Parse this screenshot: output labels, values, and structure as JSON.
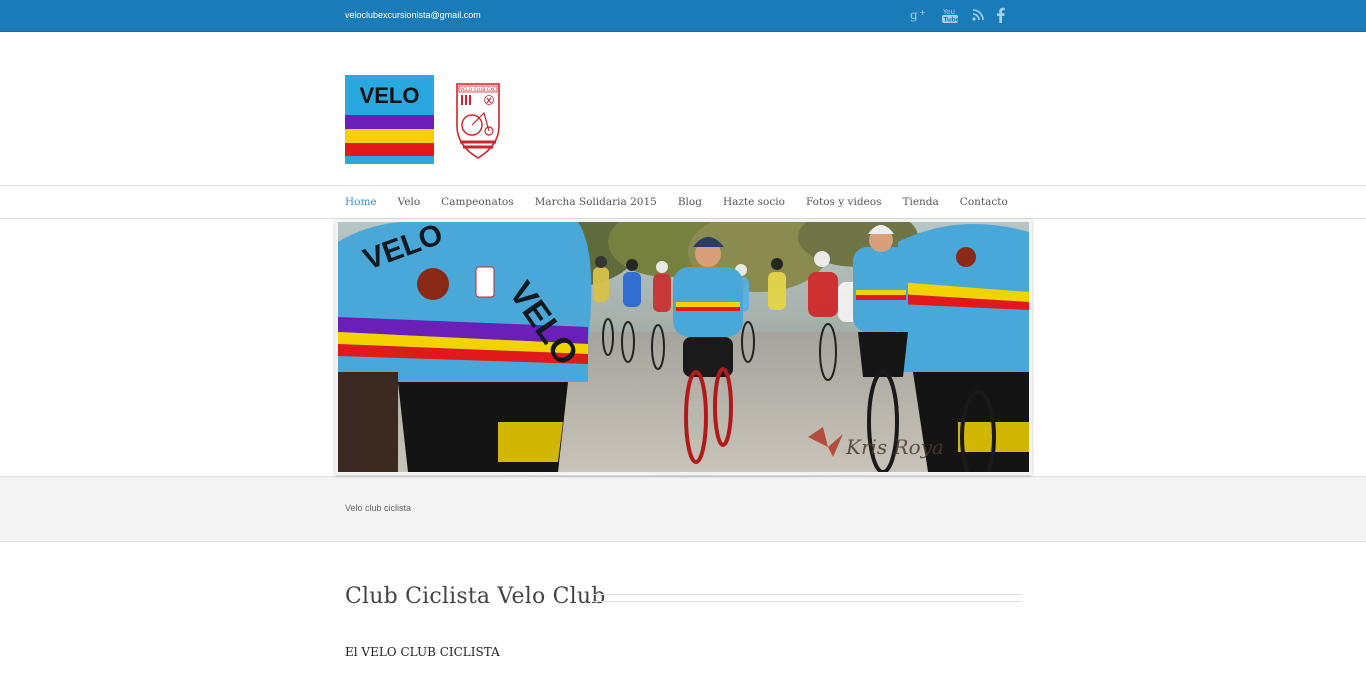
{
  "topbar": {
    "email": "veloclubexcursionista@gmail.com",
    "social": [
      {
        "name": "google-plus-icon",
        "glyph": "g+"
      },
      {
        "name": "youtube-icon",
        "glyph": "You Tube"
      },
      {
        "name": "rss-icon",
        "glyph": "rss"
      },
      {
        "name": "facebook-icon",
        "glyph": "f"
      }
    ]
  },
  "header": {
    "logo_text": "VELO",
    "badge_text": "VELO CLUB EXC"
  },
  "nav": {
    "items": [
      "Home",
      "Velo",
      "Campeonatos",
      "Marcha Solidaria 2015",
      "Blog",
      "Hazte socio",
      "Fotos y videos",
      "Tienda",
      "Contacto"
    ],
    "active": "Home"
  },
  "slider": {
    "watermark": "Kris Roya"
  },
  "tagline": "Velo club ciclista",
  "content": {
    "title": "Club Ciclista Velo Club",
    "subtitle": "El VELO CLUB CICLISTA"
  },
  "colors": {
    "topbar": "#1a7bb9",
    "nav_active": "#3a8fc9",
    "logo_sky": "#29a8e0",
    "logo_purple": "#6a1fb8",
    "logo_yellow": "#f2d200",
    "logo_red": "#e0191b",
    "jersey_blue": "#4aa8d8"
  }
}
